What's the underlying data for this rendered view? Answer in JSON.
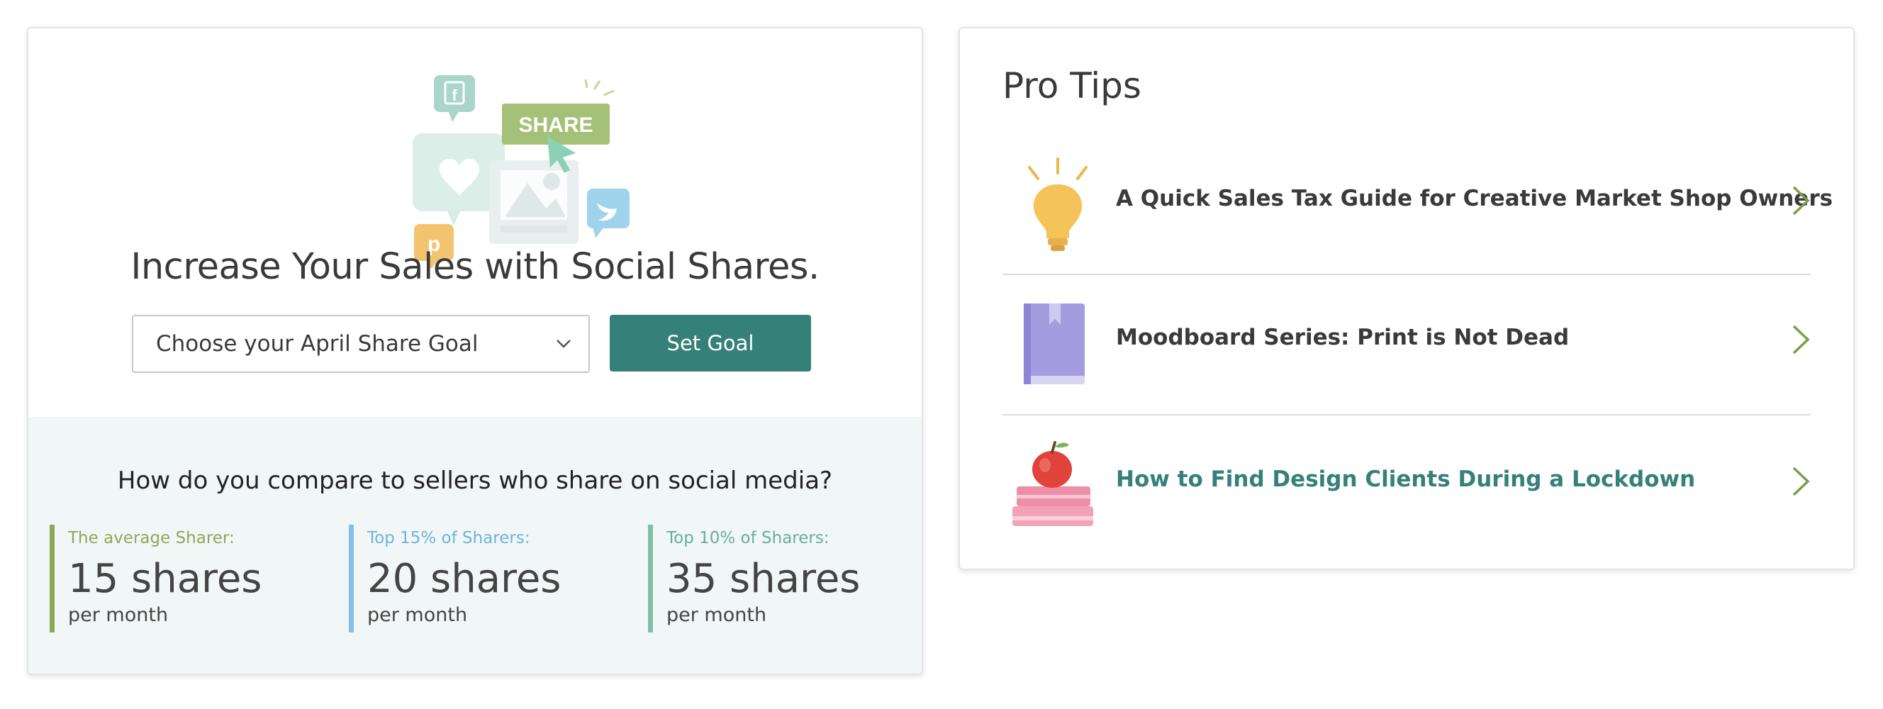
{
  "share_card": {
    "title": "Increase Your Sales with Social Shares.",
    "illustration_badge": "SHARE",
    "goal_select": {
      "value": "Choose your April Share Goal"
    },
    "set_goal_label": "Set Goal",
    "compare_question": "How do you compare to sellers who share on social media?",
    "stats": [
      {
        "label": "The average Sharer:",
        "value": "15 shares",
        "unit": "per month",
        "color": "#8ea85a"
      },
      {
        "label": "Top 15% of Sharers:",
        "value": "20 shares",
        "unit": "per month",
        "color": "#85c1e6"
      },
      {
        "label": "Top 10% of Sharers:",
        "value": "35 shares",
        "unit": "per month",
        "color": "#7fbfa8"
      }
    ]
  },
  "pro_tips": {
    "title": "Pro Tips",
    "items": [
      {
        "label": "A Quick Sales Tax Guide for Creative Market Shop Owners",
        "icon": "lightbulb-icon",
        "color": "#3a3a3a"
      },
      {
        "label": "Moodboard Series: Print is Not Dead",
        "icon": "book-icon",
        "color": "#3a3a3a"
      },
      {
        "label": "How to Find Design Clients During a Lockdown",
        "icon": "apple-books-icon",
        "color": "#36807a"
      }
    ]
  },
  "colors": {
    "accent_teal": "#36807a",
    "chevron_green": "#7a9e4a",
    "panel_bg": "#f1f7f6"
  }
}
